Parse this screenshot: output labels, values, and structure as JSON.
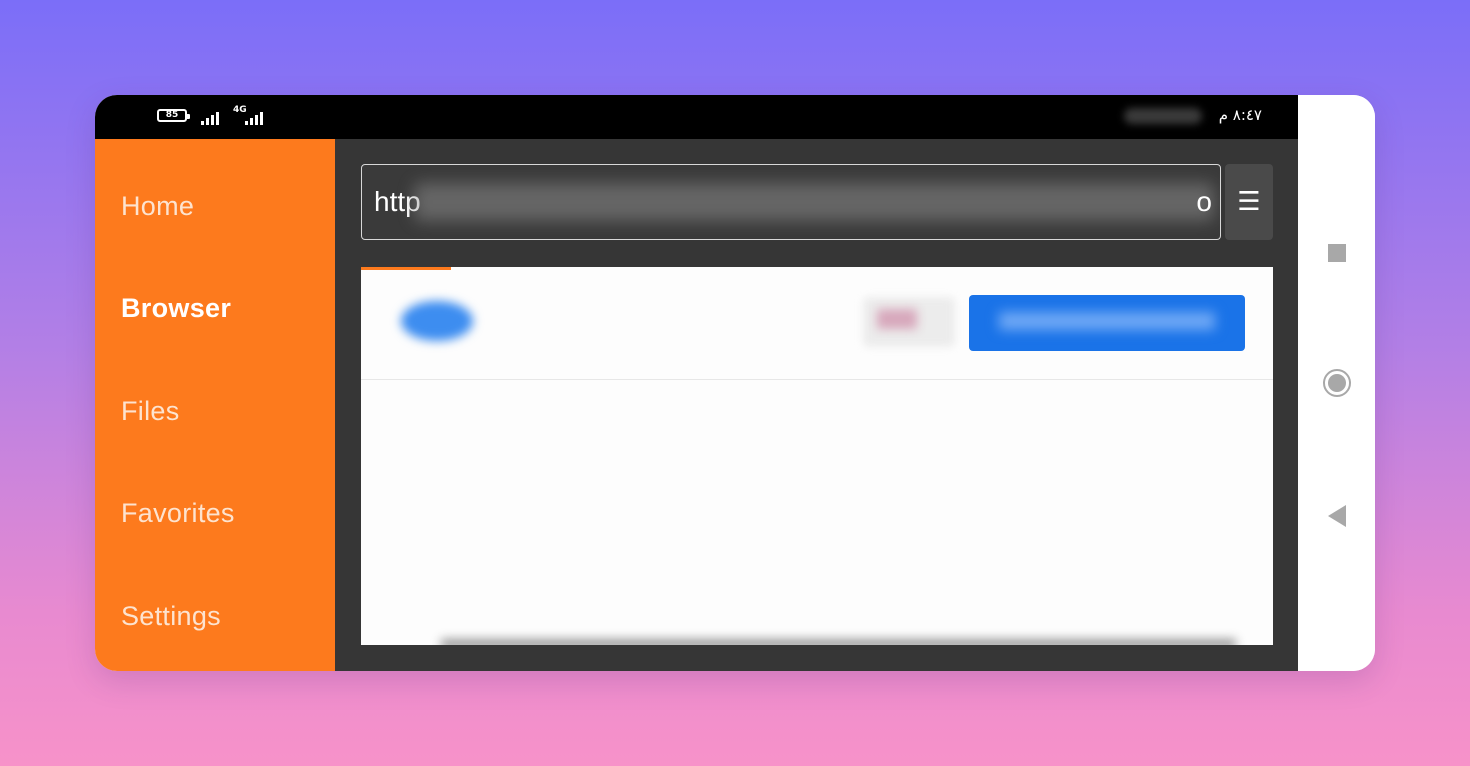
{
  "status_bar": {
    "battery": "85",
    "network": "4G",
    "time": "٨:٤٧ م"
  },
  "sidebar": {
    "items": [
      {
        "label": "Home",
        "active": false
      },
      {
        "label": "Browser",
        "active": true
      },
      {
        "label": "Files",
        "active": false
      },
      {
        "label": "Favorites",
        "active": false
      },
      {
        "label": "Settings",
        "active": false
      }
    ]
  },
  "browser": {
    "url_prefix": "http",
    "url_suffix": "o",
    "menu_icon": "☰"
  },
  "colors": {
    "sidebar": "#fd7a1d",
    "browser_bg": "#363636",
    "cta": "#1a73e8"
  },
  "icons": {
    "nav_recent": "square-icon",
    "nav_home": "circle-home-icon",
    "nav_back": "triangle-back-icon"
  }
}
